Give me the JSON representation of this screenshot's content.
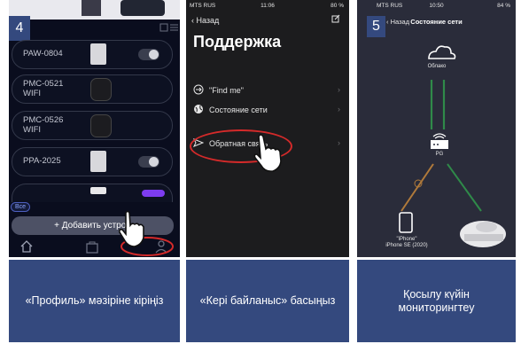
{
  "panels": [
    {
      "step": "4",
      "devices": [
        {
          "name": "PAW-0804"
        },
        {
          "name_line1": "PMC-0521",
          "name_line2": "WIFI"
        },
        {
          "name_line1": "PMC-0526",
          "name_line2": "WIFI"
        },
        {
          "name": "PPA-2025"
        }
      ],
      "all_chip": "Все",
      "add_button": "+ Добавить устрой",
      "caption": "«Профиль» мәзіріне кіріңіз"
    },
    {
      "status": {
        "carrier": "MTS RUS",
        "time": "11:06",
        "battery": "80 %"
      },
      "back": "Назад",
      "title": "Поддержка",
      "menu": [
        {
          "label": "\"Find me\"",
          "icon": "arrow-circle-icon"
        },
        {
          "label": "Состояние сети",
          "icon": "globe-icon"
        },
        {
          "label": "Обратная связь",
          "icon": "send-icon"
        }
      ],
      "caption": "«Кері байланыс» басыңыз"
    },
    {
      "step": "5",
      "status": {
        "carrier": "MTS RUS",
        "time": "10:50",
        "battery": "84 %"
      },
      "back": "Назад",
      "title": "Состояние сети",
      "cloud_label": "Облако",
      "router_label": "PG",
      "phone_label_line1": "\"iPhone\"",
      "phone_label_line2": "iPhone SE (2020)",
      "caption": "Қосылу күйін мониторингтеу"
    }
  ],
  "colors": {
    "caption_bg": "#34497e",
    "highlight": "#d42a2a",
    "accent_purple": "#7d3cf0"
  }
}
